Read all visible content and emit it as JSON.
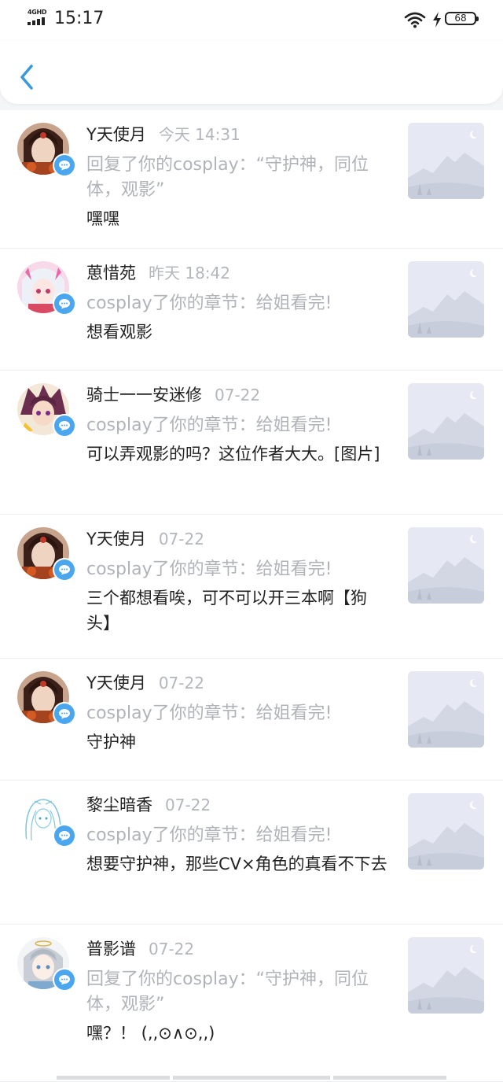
{
  "status_bar": {
    "network": "4GHD",
    "time": "15:17",
    "battery": "68"
  },
  "colors": {
    "accent": "#3a9ad9",
    "badge": "#4aa6ef",
    "muted_text": "#b0b3b8"
  },
  "items": [
    {
      "name": "Y天使月",
      "time": "今天 14:31",
      "ref": "回复了你的cosplay：“守护神，同位体，观影”",
      "message": "嘿嘿",
      "avatar": "avatar-brown"
    },
    {
      "name": "葸惜苑",
      "time": "昨天 18:42",
      "ref": "cosplay了你的章节：给姐看完!",
      "message": "想看观影",
      "avatar": "avatar-white"
    },
    {
      "name": "骑士一一安迷修",
      "time": "07-22",
      "ref": "cosplay了你的章节：给姐看完!",
      "message": "可以弄观影的吗？这位作者大大。[图片]",
      "avatar": "avatar-purple"
    },
    {
      "name": "Y天使月",
      "time": "07-22",
      "ref": "cosplay了你的章节：给姐看完!",
      "message": "三个都想看唉，可不可以开三本啊【狗头】",
      "avatar": "avatar-brown"
    },
    {
      "name": "Y天使月",
      "time": "07-22",
      "ref": "cosplay了你的章节：给姐看完!",
      "message": "守护神",
      "avatar": "avatar-brown"
    },
    {
      "name": "黎尘暗香",
      "time": "07-22",
      "ref": "cosplay了你的章节：给姐看完!",
      "message": "想要守护神，那些CV×角色的真看不下去",
      "avatar": "avatar-sketch"
    },
    {
      "name": "普影谱",
      "time": "07-22",
      "ref": "回复了你的cosplay：“守护神，同位体，观影”",
      "message": "嘿？！ (,,⊙∧⊙,,)",
      "avatar": "avatar-silver"
    }
  ]
}
